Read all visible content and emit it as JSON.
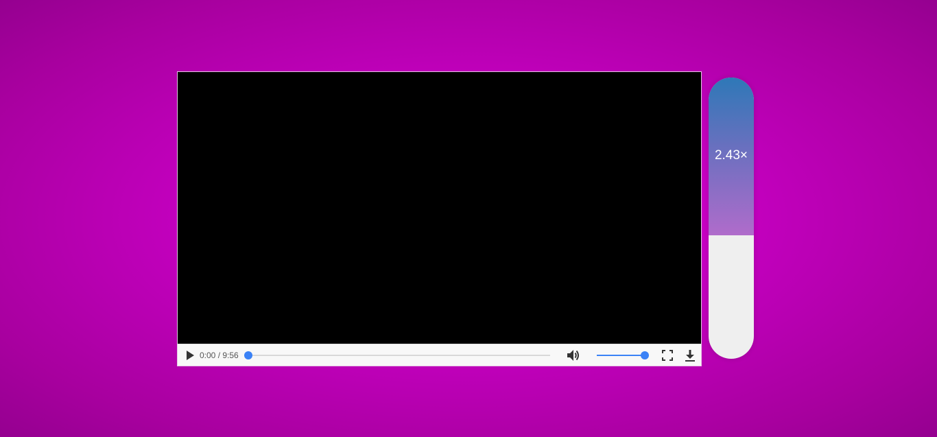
{
  "player": {
    "current_time": "0:00",
    "separator": " / ",
    "duration": "9:56",
    "seek_progress": 0.0,
    "volume_level": 1.0,
    "accent_color": "#3b82f6"
  },
  "speed": {
    "label": "2.43×",
    "fill_fraction": 0.56,
    "gradient_top": "#2e78b7",
    "gradient_bottom": "#b06ccb"
  },
  "icons": {
    "play": "play-icon",
    "volume": "volume-icon",
    "fullscreen": "fullscreen-icon",
    "download": "download-icon"
  },
  "colors": {
    "background": "#d000cc",
    "video": "#000000",
    "controls_bg": "#f8f8f8"
  }
}
